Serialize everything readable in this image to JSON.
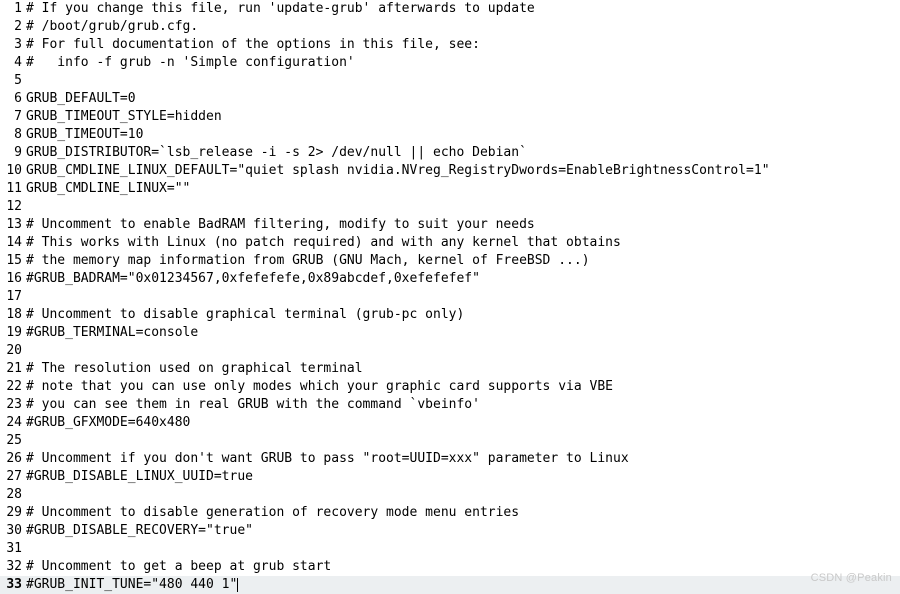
{
  "lines": [
    {
      "n": 1,
      "text": "# If you change this file, run 'update-grub' afterwards to update"
    },
    {
      "n": 2,
      "text": "# /boot/grub/grub.cfg."
    },
    {
      "n": 3,
      "text": "# For full documentation of the options in this file, see:"
    },
    {
      "n": 4,
      "text": "#   info -f grub -n 'Simple configuration'"
    },
    {
      "n": 5,
      "text": ""
    },
    {
      "n": 6,
      "text": "GRUB_DEFAULT=0"
    },
    {
      "n": 7,
      "text": "GRUB_TIMEOUT_STYLE=hidden"
    },
    {
      "n": 8,
      "text": "GRUB_TIMEOUT=10"
    },
    {
      "n": 9,
      "text": "GRUB_DISTRIBUTOR=`lsb_release -i -s 2> /dev/null || echo Debian`"
    },
    {
      "n": 10,
      "text": "GRUB_CMDLINE_LINUX_DEFAULT=\"quiet splash nvidia.NVreg_RegistryDwords=EnableBrightnessControl=1\""
    },
    {
      "n": 11,
      "text": "GRUB_CMDLINE_LINUX=\"\""
    },
    {
      "n": 12,
      "text": ""
    },
    {
      "n": 13,
      "text": "# Uncomment to enable BadRAM filtering, modify to suit your needs"
    },
    {
      "n": 14,
      "text": "# This works with Linux (no patch required) and with any kernel that obtains"
    },
    {
      "n": 15,
      "text": "# the memory map information from GRUB (GNU Mach, kernel of FreeBSD ...)"
    },
    {
      "n": 16,
      "text": "#GRUB_BADRAM=\"0x01234567,0xfefefefe,0x89abcdef,0xefefefef\""
    },
    {
      "n": 17,
      "text": ""
    },
    {
      "n": 18,
      "text": "# Uncomment to disable graphical terminal (grub-pc only)"
    },
    {
      "n": 19,
      "text": "#GRUB_TERMINAL=console"
    },
    {
      "n": 20,
      "text": ""
    },
    {
      "n": 21,
      "text": "# The resolution used on graphical terminal"
    },
    {
      "n": 22,
      "text": "# note that you can use only modes which your graphic card supports via VBE"
    },
    {
      "n": 23,
      "text": "# you can see them in real GRUB with the command `vbeinfo'"
    },
    {
      "n": 24,
      "text": "#GRUB_GFXMODE=640x480"
    },
    {
      "n": 25,
      "text": ""
    },
    {
      "n": 26,
      "text": "# Uncomment if you don't want GRUB to pass \"root=UUID=xxx\" parameter to Linux"
    },
    {
      "n": 27,
      "text": "#GRUB_DISABLE_LINUX_UUID=true"
    },
    {
      "n": 28,
      "text": ""
    },
    {
      "n": 29,
      "text": "# Uncomment to disable generation of recovery mode menu entries"
    },
    {
      "n": 30,
      "text": "#GRUB_DISABLE_RECOVERY=\"true\""
    },
    {
      "n": 31,
      "text": ""
    },
    {
      "n": 32,
      "text": "# Uncomment to get a beep at grub start"
    },
    {
      "n": 33,
      "text": "#GRUB_INIT_TUNE=\"480 440 1\""
    }
  ],
  "current_line": 33,
  "watermark": "CSDN @Peakin"
}
